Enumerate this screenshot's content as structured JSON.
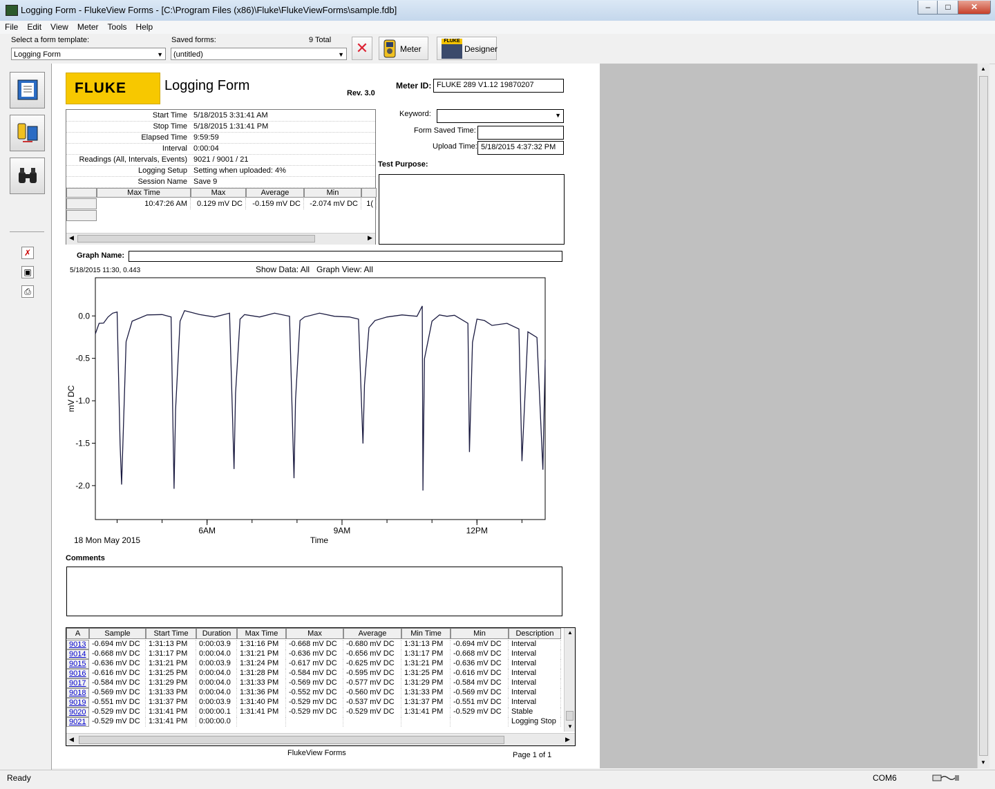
{
  "window": {
    "title": "Logging Form - FlukeView Forms - [C:\\Program Files (x86)\\Fluke\\FlukeViewForms\\sample.fdb]",
    "minimize": "–",
    "maximize": "□",
    "close": "✕"
  },
  "menu": [
    "File",
    "Edit",
    "View",
    "Meter",
    "Tools",
    "Help"
  ],
  "toolbar": {
    "template_label": "Select a form template:",
    "template_value": "Logging Form",
    "saved_label": "Saved forms:",
    "saved_count": "9  Total",
    "saved_value": "(untitled)",
    "meter_label": "Meter",
    "designer_label": "Designer",
    "designer_badge": "FLUKE"
  },
  "form": {
    "logo": "FLUKE",
    "title": "Logging Form",
    "rev": "Rev. 3.0",
    "meter_id_label": "Meter ID:",
    "meter_id": "FLUKE 289  V1.12  19870207",
    "keyword_label": "Keyword:",
    "form_saved_label": "Form Saved Time:",
    "upload_label": "Upload Time:",
    "upload_time": "5/18/2015 4:37:32 PM",
    "test_purpose_label": "Test Purpose:",
    "info": [
      {
        "k": "Start Time",
        "v": "5/18/2015 3:31:41 AM"
      },
      {
        "k": "Stop Time",
        "v": "5/18/2015 1:31:41 PM"
      },
      {
        "k": "Elapsed Time",
        "v": "9:59:59"
      },
      {
        "k": "Interval",
        "v": "0:00:04"
      },
      {
        "k": "Readings (All, Intervals, Events)",
        "v": "9021 / 9001 / 21"
      },
      {
        "k": "Logging Setup",
        "v": "Setting when uploaded: 4%"
      },
      {
        "k": "Session Name",
        "v": "Save 9"
      }
    ],
    "summary_headers": [
      "Max Time",
      "Max",
      "Average",
      "Min"
    ],
    "summary_values": [
      "10:47:26 AM",
      "0.129 mV DC",
      "-0.159 mV DC",
      "-2.074 mV DC",
      "1("
    ],
    "graph_name_label": "Graph Name:",
    "cursor_readout": "5/18/2015 11:30, 0.443",
    "show_data": "Show Data: All   Graph View: All",
    "comments_label": "Comments",
    "footer_center": "FlukeView Forms",
    "footer_page": "Page 1 of 1"
  },
  "chart_data": {
    "type": "line",
    "title": "",
    "xlabel": "Time",
    "ylabel": "mV DC",
    "date_label": "18 Mon May 2015",
    "x_ticks": [
      "6AM",
      "9AM",
      "12PM"
    ],
    "y_ticks": [
      "0.0",
      "-0.5",
      "-1.0",
      "-1.5",
      "-2.0"
    ],
    "ylim": [
      -2.4,
      0.45
    ],
    "xlim": [
      "03:31",
      "13:31"
    ],
    "series": [
      {
        "name": "",
        "color": "#1a1a40",
        "x": [
          "03:31",
          "03:36",
          "03:42",
          "03:48",
          "03:54",
          "04:00",
          "04:04",
          "04:06",
          "04:12",
          "04:20",
          "04:40",
          "05:00",
          "05:12",
          "05:16",
          "05:18",
          "05:24",
          "05:30",
          "05:50",
          "06:10",
          "06:30",
          "06:36",
          "06:38",
          "06:44",
          "06:50",
          "07:10",
          "07:30",
          "07:50",
          "07:56",
          "07:58",
          "08:04",
          "08:10",
          "08:30",
          "08:50",
          "09:10",
          "09:22",
          "09:28",
          "09:30",
          "09:36",
          "09:44",
          "10:00",
          "10:20",
          "10:40",
          "10:47",
          "10:48",
          "10:50",
          "11:00",
          "11:10",
          "11:20",
          "11:30",
          "11:48",
          "11:50",
          "11:54",
          "12:00",
          "12:10",
          "12:20",
          "12:40",
          "12:56",
          "13:00",
          "13:08",
          "13:20",
          "13:28",
          "13:31"
        ],
        "y": [
          -0.2,
          -0.1,
          -0.08,
          0.0,
          0.02,
          0.05,
          -1.5,
          -2.0,
          -0.3,
          -0.05,
          0.0,
          0.02,
          0.0,
          -2.05,
          -1.1,
          -0.05,
          0.05,
          0.02,
          0.0,
          0.02,
          -1.8,
          -0.9,
          -0.05,
          0.02,
          0.0,
          0.02,
          0.0,
          -1.9,
          -1.0,
          -0.05,
          0.0,
          0.02,
          0.0,
          0.0,
          -0.05,
          -1.5,
          -0.8,
          -0.15,
          -0.05,
          0.0,
          0.0,
          0.0,
          0.129,
          -2.07,
          -0.5,
          -0.05,
          0.0,
          0.0,
          0.02,
          -0.1,
          -1.6,
          -0.3,
          -0.05,
          -0.05,
          -0.1,
          -0.1,
          -0.15,
          -1.7,
          -0.2,
          -0.25,
          -1.8,
          -0.529
        ]
      }
    ]
  },
  "readings_table": {
    "headers": [
      "A",
      "Sample",
      "Start Time",
      "Duration",
      "Max Time",
      "Max",
      "Average",
      "Min Time",
      "Min",
      "Description"
    ],
    "rows": [
      [
        "9013",
        "-0.694 mV DC",
        "1:31:13 PM",
        "0:00:03.9",
        "1:31:16 PM",
        "-0.668 mV DC",
        "-0.680 mV DC",
        "1:31:13 PM",
        "-0.694 mV DC",
        "Interval"
      ],
      [
        "9014",
        "-0.668 mV DC",
        "1:31:17 PM",
        "0:00:04.0",
        "1:31:21 PM",
        "-0.636 mV DC",
        "-0.656 mV DC",
        "1:31:17 PM",
        "-0.668 mV DC",
        "Interval"
      ],
      [
        "9015",
        "-0.636 mV DC",
        "1:31:21 PM",
        "0:00:03.9",
        "1:31:24 PM",
        "-0.617 mV DC",
        "-0.625 mV DC",
        "1:31:21 PM",
        "-0.636 mV DC",
        "Interval"
      ],
      [
        "9016",
        "-0.616 mV DC",
        "1:31:25 PM",
        "0:00:04.0",
        "1:31:28 PM",
        "-0.584 mV DC",
        "-0.595 mV DC",
        "1:31:25 PM",
        "-0.616 mV DC",
        "Interval"
      ],
      [
        "9017",
        "-0.584 mV DC",
        "1:31:29 PM",
        "0:00:04.0",
        "1:31:33 PM",
        "-0.569 mV DC",
        "-0.577 mV DC",
        "1:31:29 PM",
        "-0.584 mV DC",
        "Interval"
      ],
      [
        "9018",
        "-0.569 mV DC",
        "1:31:33 PM",
        "0:00:04.0",
        "1:31:36 PM",
        "-0.552 mV DC",
        "-0.560 mV DC",
        "1:31:33 PM",
        "-0.569 mV DC",
        "Interval"
      ],
      [
        "9019",
        "-0.551 mV DC",
        "1:31:37 PM",
        "0:00:03.9",
        "1:31:40 PM",
        "-0.529 mV DC",
        "-0.537 mV DC",
        "1:31:37 PM",
        "-0.551 mV DC",
        "Interval"
      ],
      [
        "9020",
        "-0.529 mV DC",
        "1:31:41 PM",
        "0:00:00.1",
        "1:31:41 PM",
        "-0.529 mV DC",
        "-0.529 mV DC",
        "1:31:41 PM",
        "-0.529 mV DC",
        "Stable"
      ],
      [
        "9021",
        "-0.529 mV DC",
        "1:31:41 PM",
        "0:00:00.0",
        "",
        "",
        "",
        "",
        "",
        "Logging Stop"
      ]
    ]
  },
  "status": {
    "left": "Ready",
    "port": "COM6"
  },
  "icons": [
    "app-icon",
    "form-view-icon",
    "meter-transfer-icon",
    "binoculars-icon",
    "delete-form-icon",
    "save-icon",
    "print-icon",
    "meter-icon",
    "designer-icon",
    "delete-icon",
    "connection-icon"
  ]
}
